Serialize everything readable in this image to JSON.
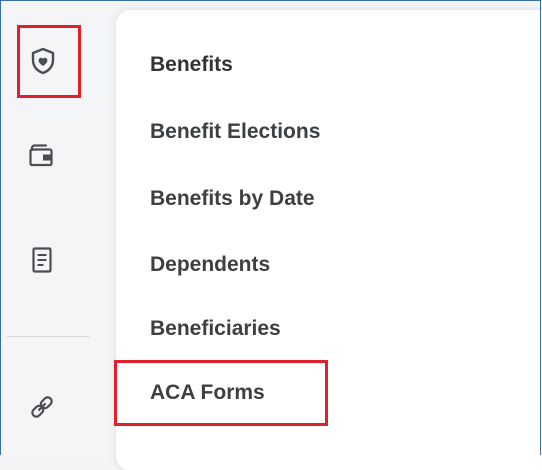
{
  "rail": {
    "icons": [
      {
        "name": "benefits-shield-icon",
        "active": true
      },
      {
        "name": "wallet-icon",
        "active": false
      },
      {
        "name": "document-icon",
        "active": false
      },
      {
        "name": "link-icon",
        "active": false
      }
    ]
  },
  "menu": {
    "heading": "Benefits",
    "items": [
      {
        "label": "Benefit Elections"
      },
      {
        "label": "Benefits by Date"
      },
      {
        "label": "Dependents"
      },
      {
        "label": "Beneficiaries"
      },
      {
        "label": "ACA Forms",
        "highlighted": true
      }
    ]
  },
  "colors": {
    "highlight": "#e0202a",
    "icon": "#4a4d52",
    "text": "#3c4043"
  }
}
